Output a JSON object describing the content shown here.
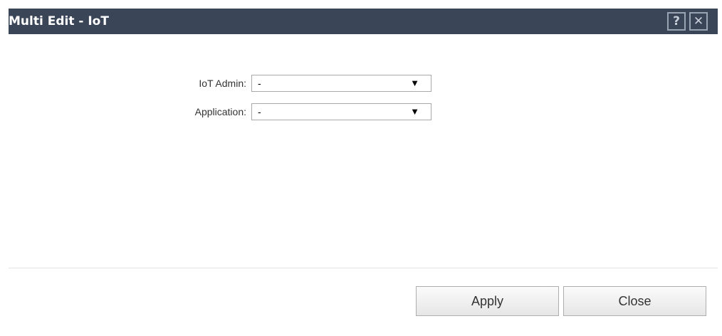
{
  "dialog": {
    "title": "Multi Edit - IoT",
    "help_icon": "?",
    "close_icon": "✕"
  },
  "form": {
    "iot_admin": {
      "label": "IoT Admin:",
      "value": "-",
      "arrow": "▼"
    },
    "application": {
      "label": "Application:",
      "value": "-",
      "arrow": "▼"
    }
  },
  "footer": {
    "apply_label": "Apply",
    "close_label": "Close"
  }
}
